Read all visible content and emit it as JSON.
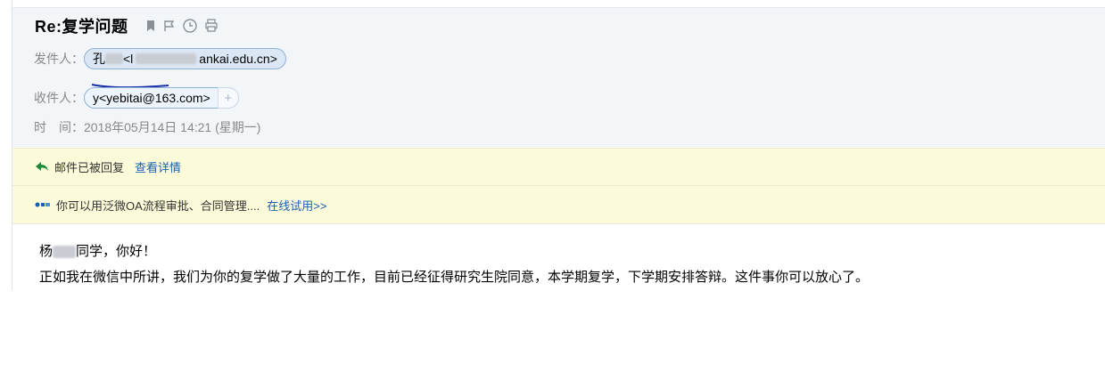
{
  "email": {
    "subject": "Re:复学问题",
    "sender_label": "发件人：",
    "sender_name_visible": "孔",
    "sender_email_prefix": "<l",
    "sender_email_suffix": "ankai.edu.cn>",
    "recipient_label": "收件人：",
    "recipient": "y<yebitai@163.com>",
    "add_recipient": "+",
    "time_label": "时　间：",
    "time_value": "2018年05月14日 14:21 (星期一)"
  },
  "notices": {
    "replied_text": "邮件已被回复",
    "replied_link": "查看详情",
    "promo_text": "你可以用泛微OA流程审批、合同管理....",
    "promo_link": "在线试用>>"
  },
  "body": {
    "greeting_prefix": "杨",
    "greeting_suffix": "同学，你好！",
    "paragraph": "正如我在微信中所讲，我们为你的复学做了大量的工作，目前已经征得研究生院同意，本学期复学，下学期安排答辩。这件事你可以放心了。"
  },
  "icons": [
    "bookmark-icon",
    "flag-icon",
    "clock-icon",
    "print-icon",
    "reply-arrow-icon",
    "oa-logo-icon"
  ],
  "colors": {
    "link": "#1b5fb4",
    "notice_bg": "#fcfbd9",
    "header_bg": "#f3f6f9",
    "chip_border": "#8fb2d6"
  }
}
